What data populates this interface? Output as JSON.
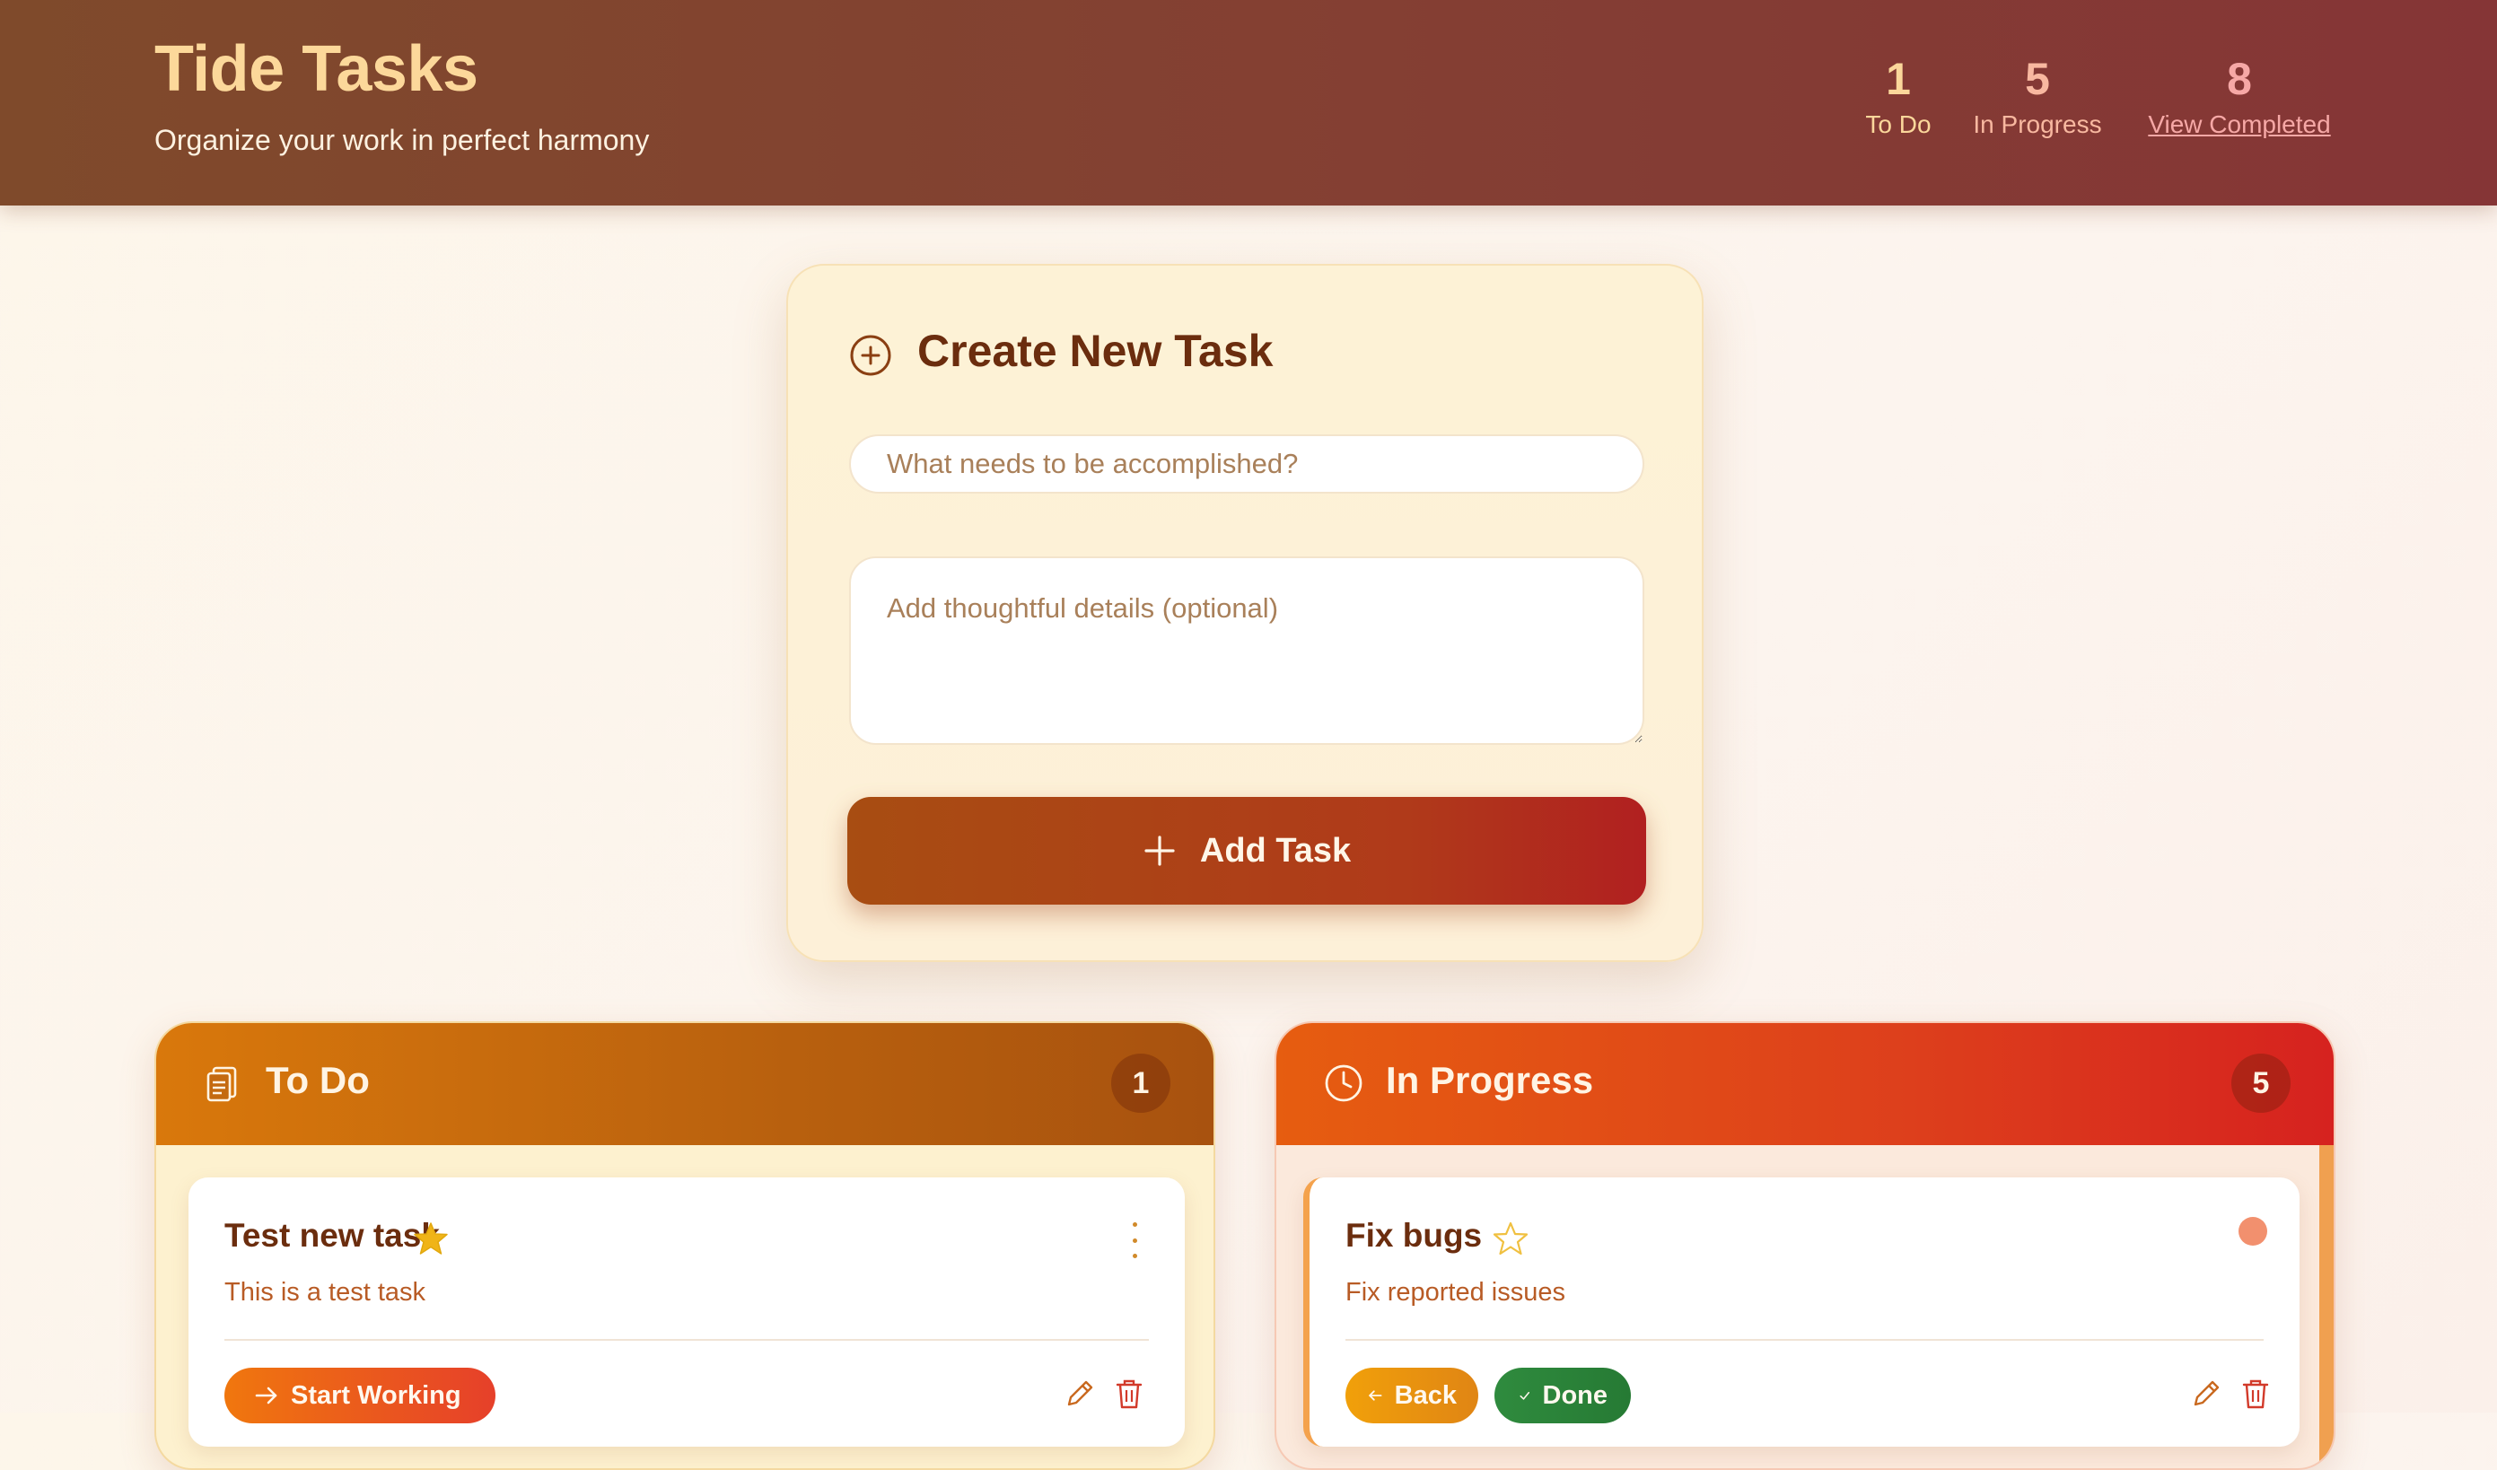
{
  "header": {
    "title": "Tide Tasks",
    "subtitle": "Organize your work in perfect harmony",
    "stats": [
      {
        "value": "1",
        "label": "To Do"
      },
      {
        "value": "5",
        "label": "In Progress"
      },
      {
        "value": "8",
        "label": "View Completed"
      }
    ]
  },
  "create": {
    "title": "Create New Task",
    "title_placeholder": "What needs to be accomplished?",
    "details_placeholder": "Add thoughtful details (optional)",
    "add_label": "Add Task"
  },
  "columns": {
    "todo": {
      "title": "To Do",
      "count": "1",
      "icon": "clipboard-icon",
      "task": {
        "title": "Test new task",
        "description": "This is a test task",
        "starred": true,
        "action_label": "Start Working"
      }
    },
    "in_progress": {
      "title": "In Progress",
      "count": "5",
      "icon": "clock-icon",
      "task": {
        "title": "Fix bugs",
        "description": "Fix reported issues",
        "starred": false,
        "back_label": "Back",
        "done_label": "Done",
        "priority_color": "#f2906e"
      }
    }
  },
  "colors": {
    "header_start": "#7f4a2b",
    "header_end": "#853536",
    "accent_gold": "#fcd89a",
    "todo_header": "#d9780c",
    "progress_header": "#e65d10",
    "add_button": "#a84d12"
  }
}
